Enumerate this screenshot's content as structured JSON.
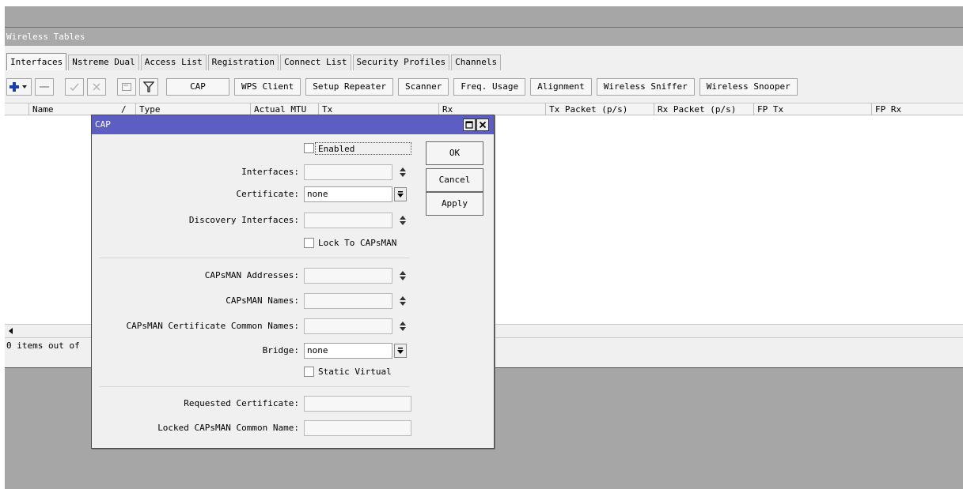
{
  "window": {
    "title": "Wireless Tables",
    "tabs": [
      "Interfaces",
      "Nstreme Dual",
      "Access List",
      "Registration",
      "Connect List",
      "Security Profiles",
      "Channels"
    ],
    "active_tab": "Interfaces"
  },
  "toolbar": {
    "icons": [
      "add-icon",
      "remove-icon",
      "enable-icon",
      "disable-icon",
      "comment-icon",
      "filter-icon"
    ],
    "buttons": [
      "CAP",
      "WPS Client",
      "Setup Repeater",
      "Scanner",
      "Freq. Usage",
      "Alignment",
      "Wireless Sniffer",
      "Wireless Snooper"
    ]
  },
  "table": {
    "columns": [
      "Name",
      "Type",
      "Actual MTU",
      "Tx",
      "Rx",
      "Tx Packet (p/s)",
      "Rx Packet (p/s)",
      "FP Tx",
      "FP Rx"
    ],
    "sort_indicator": "/",
    "status": "0 items out of"
  },
  "dialog": {
    "title": "CAP",
    "enabled_label": "Enabled",
    "enabled_checked": false,
    "ok_label": "OK",
    "cancel_label": "Cancel",
    "apply_label": "Apply",
    "fields": {
      "interfaces_label": "Interfaces:",
      "interfaces_value": "",
      "certificate_label": "Certificate:",
      "certificate_value": "none",
      "discovery_label": "Discovery Interfaces:",
      "discovery_value": "",
      "lock_label": "Lock To CAPsMAN",
      "capsman_addresses_label": "CAPsMAN Addresses:",
      "capsman_addresses_value": "",
      "capsman_names_label": "CAPsMAN Names:",
      "capsman_names_value": "",
      "capsman_cert_label": "CAPsMAN Certificate Common Names:",
      "capsman_cert_value": "",
      "bridge_label": "Bridge:",
      "bridge_value": "none",
      "static_virtual_label": "Static Virtual",
      "requested_cert_label": "Requested Certificate:",
      "requested_cert_value": "",
      "locked_common_label": "Locked CAPsMAN Common Name:",
      "locked_common_value": ""
    }
  },
  "colors": {
    "dialog_title_bg": "#5c5ec2",
    "window_title_bg": "#a9a9a9",
    "desktop_bg": "#a6a6a6"
  }
}
